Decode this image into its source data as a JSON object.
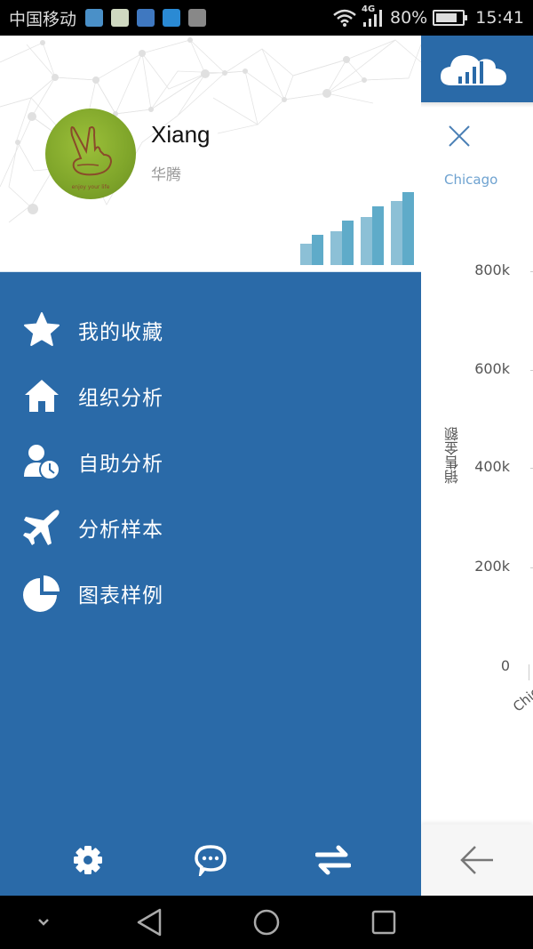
{
  "status_bar": {
    "carrier": "中国移动",
    "notification_icons": [
      {
        "name": "browser-app-icon",
        "color": "#4a90c8"
      },
      {
        "name": "frog-app-icon",
        "color": "#cfd8c0"
      },
      {
        "name": "health-app-icon",
        "color": "#3f78c0"
      },
      {
        "name": "card-app-icon",
        "color": "#2a8ad4"
      },
      {
        "name": "gallery-app-icon",
        "color": "#888888"
      }
    ],
    "network": "4G",
    "battery_percent_label": "80%",
    "battery_level": 0.8,
    "time": "15:41"
  },
  "drawer": {
    "user": {
      "name": "Xiang",
      "organization": "华腾",
      "avatar_caption": "enjoy your life"
    },
    "menu": [
      {
        "id": "favorites",
        "label": "我的收藏",
        "icon": "star-icon"
      },
      {
        "id": "org-analysis",
        "label": "组织分析",
        "icon": "home-icon"
      },
      {
        "id": "self-analysis",
        "label": "自助分析",
        "icon": "user-clock-icon"
      },
      {
        "id": "samples",
        "label": "分析样本",
        "icon": "airplane-icon"
      },
      {
        "id": "chart-examples",
        "label": "图表样例",
        "icon": "pie-chart-icon"
      }
    ],
    "footer": [
      {
        "id": "settings",
        "icon": "gear-icon"
      },
      {
        "id": "messages",
        "icon": "chat-bubble-icon"
      },
      {
        "id": "switch",
        "icon": "swap-arrows-icon"
      }
    ]
  },
  "background_page": {
    "tab_label": "Chicago",
    "y_axis_title": "销售金额",
    "y_ticks": [
      "800k",
      "600k",
      "400k",
      "200k",
      "0"
    ],
    "x_label_partial": "Chic"
  },
  "colors": {
    "primary": "#2a6aa8",
    "accent_light": "#6ea2d0",
    "text_muted": "#999999"
  }
}
